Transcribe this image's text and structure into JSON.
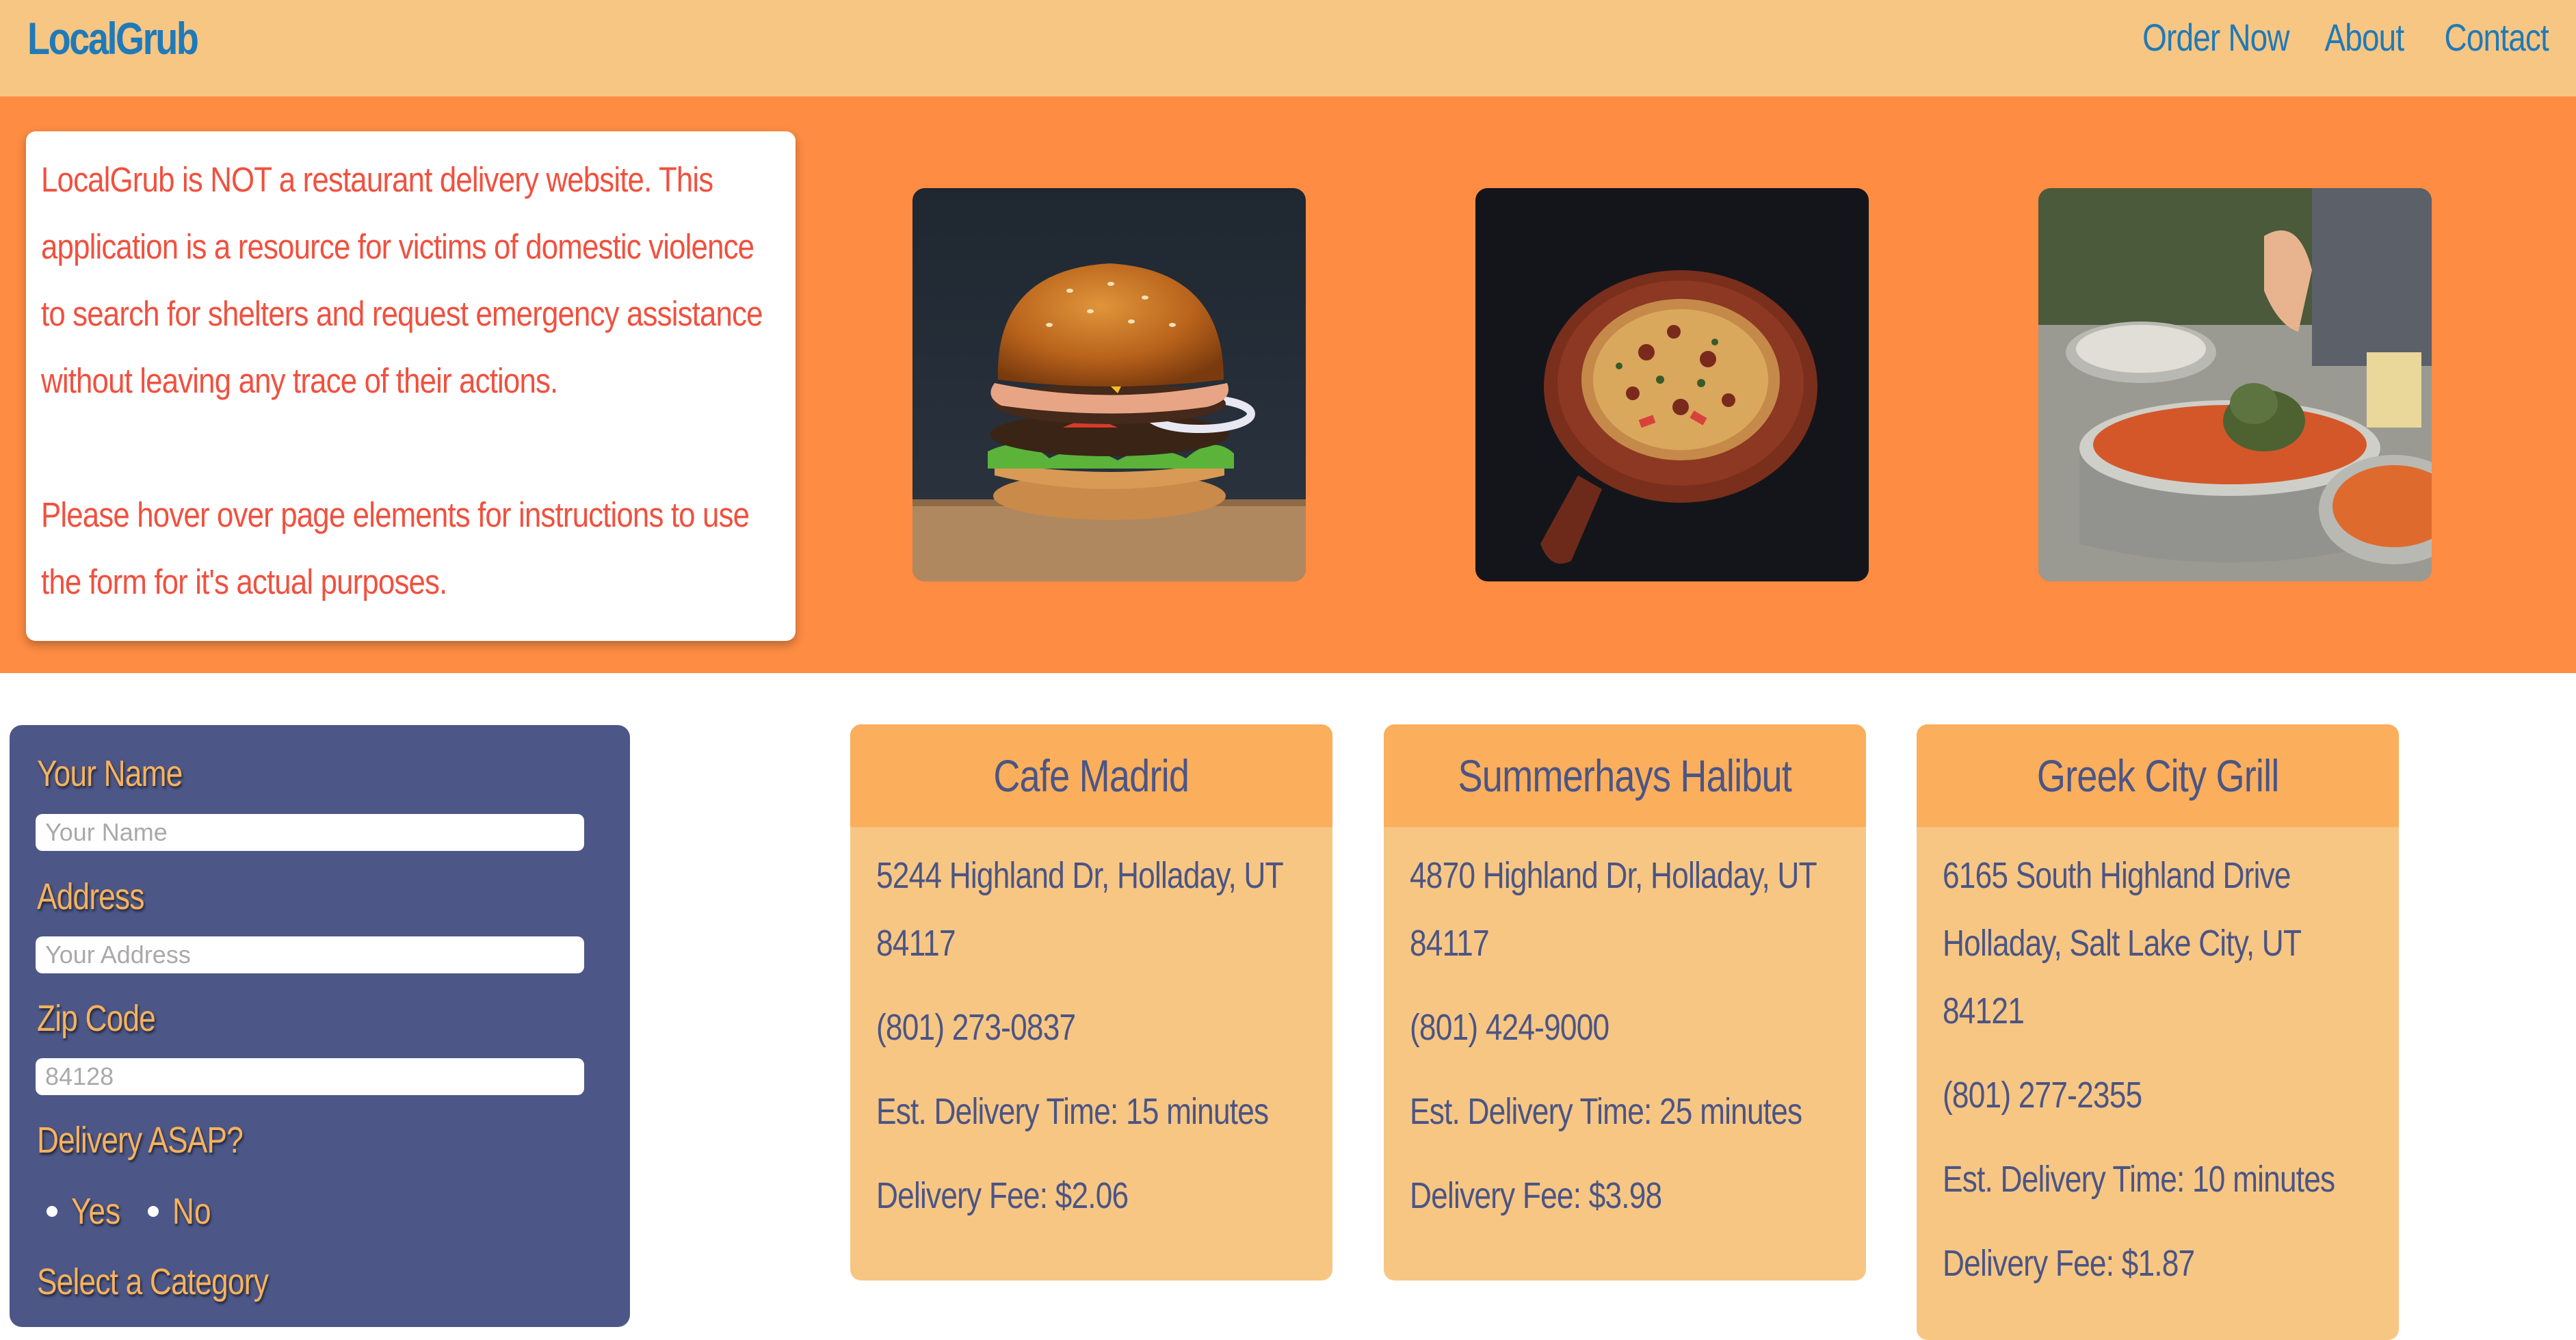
{
  "navbar": {
    "brand": "LocalGrub",
    "links": [
      "Order Now",
      "About",
      "Contact"
    ]
  },
  "hero": {
    "notice_paragraphs": [
      "LocalGrub is NOT a restaurant delivery website. This application is a resource for victims of domestic violence to search for shelters and request emergency assistance without leaving any trace of their actions.",
      "Please hover over page elements for instructions to use the form for it's actual purposes."
    ],
    "images": [
      "burger-photo",
      "pizza-photo",
      "soup-cooking-photo"
    ]
  },
  "form": {
    "name_label": "Your Name",
    "name_placeholder": "Your Name",
    "address_label": "Address",
    "address_placeholder": "Your Address",
    "zip_label": "Zip Code",
    "zip_placeholder": "84128",
    "asap_label": "Delivery ASAP?",
    "asap_options": [
      "Yes",
      "No"
    ],
    "category_label": "Select a Category"
  },
  "restaurants": [
    {
      "name": "Cafe Madrid",
      "address_lines": [
        "5244 Highland Dr, Holladay, UT",
        "84117"
      ],
      "phone": "(801) 273-0837",
      "delivery_time": "Est. Delivery Time: 15 minutes",
      "delivery_fee": "Delivery Fee: $2.06"
    },
    {
      "name": "Summerhays Halibut",
      "address_lines": [
        "4870 Highland Dr, Holladay, UT",
        "84117"
      ],
      "phone": "(801) 424-9000",
      "delivery_time": "Est. Delivery Time: 25 minutes",
      "delivery_fee": "Delivery Fee: $3.98"
    },
    {
      "name": "Greek City Grill",
      "address_lines": [
        "6165 South Highland Drive",
        "Holladay, Salt Lake City, UT",
        "84121"
      ],
      "phone": "(801) 277-2355",
      "delivery_time": "Est. Delivery Time: 10 minutes",
      "delivery_fee": "Delivery Fee: $1.87"
    }
  ],
  "colors": {
    "navbar_bg": "#f7c683",
    "hero_bg": "#fe8c43",
    "brand_blue": "#1f7ab8",
    "notice_text": "#f0513f",
    "form_bg": "#4c5787",
    "form_label": "#f7b25d",
    "card_bg": "#f7c683",
    "card_header_bg": "#fbae5b",
    "card_text": "#4b5585"
  }
}
